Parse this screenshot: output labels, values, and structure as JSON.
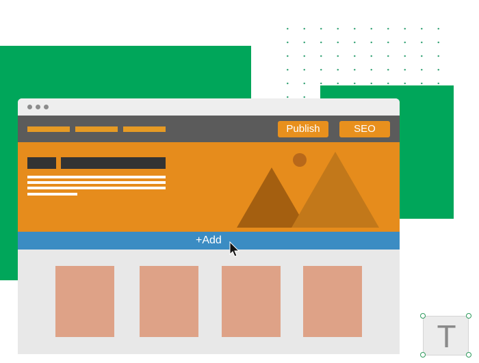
{
  "toolbar": {
    "publish_label": "Publish",
    "seo_label": "SEO"
  },
  "add_bar": {
    "label": "+Add"
  },
  "text_tool": {
    "glyph": "T"
  },
  "colors": {
    "green": "#00a65a",
    "orange": "#e68c1c",
    "blue": "#3b8cc3",
    "card": "#dea287",
    "navbar": "#5b5b5b"
  },
  "icons": [
    "window-dots-icon",
    "mountain-illustration",
    "cursor-icon",
    "text-tool-icon"
  ]
}
